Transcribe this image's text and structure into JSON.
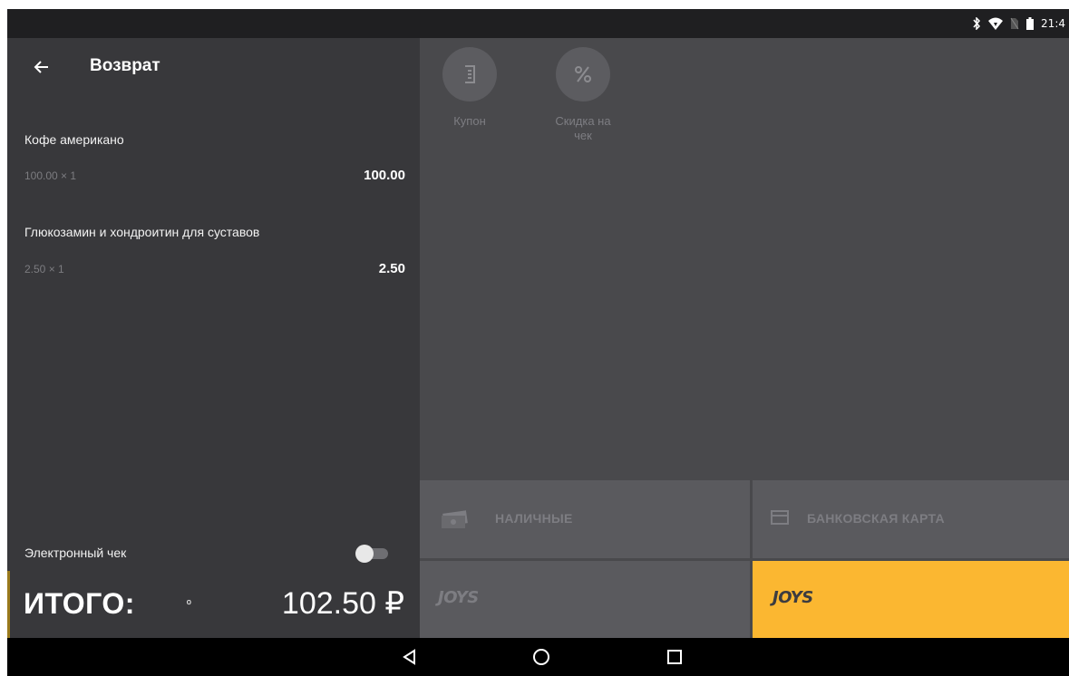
{
  "status_bar": {
    "time": "21:4",
    "icons": [
      "bluetooth-icon",
      "wifi-icon",
      "no-sim-icon",
      "battery-icon"
    ]
  },
  "header": {
    "back_icon": "arrow-left-icon",
    "title": "Возврат"
  },
  "receipt": {
    "items": [
      {
        "name": "Кофе американо",
        "qty": "100.00 × 1",
        "sum": "100.00"
      },
      {
        "name": "Глюкозамин и хондроитин для суставов",
        "qty": "2.50 × 1",
        "sum": "2.50"
      }
    ],
    "electronic_check": {
      "label": "Электронный чек",
      "enabled": false
    }
  },
  "total": {
    "label": "ИТОГО:",
    "marker": "º",
    "amount": "102.50 ₽"
  },
  "tools": [
    {
      "label": "Купон",
      "icon": "coupon-icon"
    },
    {
      "label": "Скидка на чек",
      "icon": "percent-icon"
    }
  ],
  "payments": {
    "cash": {
      "label": "НАЛИЧНЫЕ",
      "icon": "cash-icon"
    },
    "card": {
      "label": "БАНКОВСКАЯ КАРТА",
      "icon": "card-icon"
    },
    "joys_left": {
      "label": "JOYS"
    },
    "joys_right": {
      "label": "JOYS",
      "highlighted": true
    }
  },
  "colors": {
    "accent": "#fbb731",
    "panel_dark": "#38383b",
    "panel_right": "#49494c",
    "button_tile": "#5a5a5e"
  },
  "nav": {
    "icons": [
      "back-triangle-icon",
      "home-circle-icon",
      "recents-square-icon"
    ]
  }
}
